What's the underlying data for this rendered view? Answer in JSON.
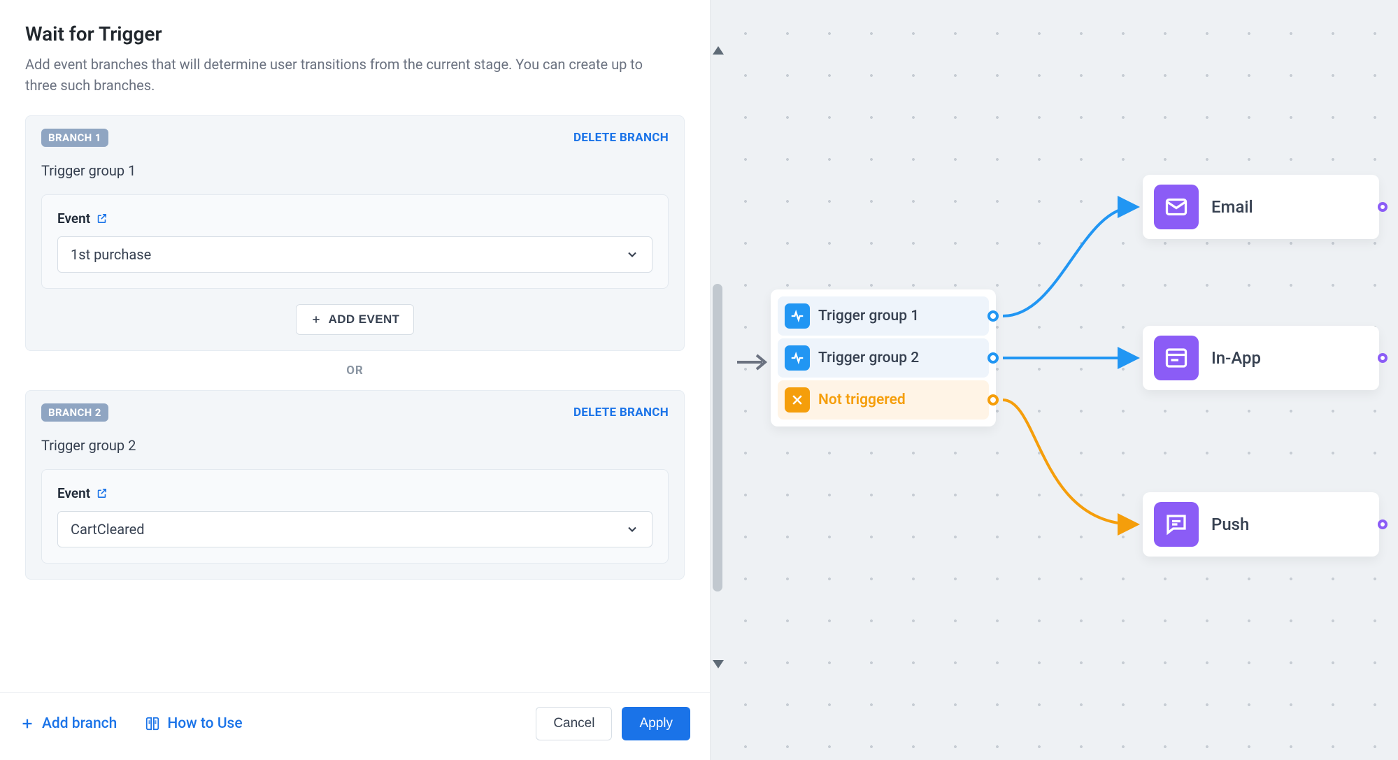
{
  "page": {
    "title": "Wait for Trigger",
    "description": "Add event branches that will determine user transitions from the current stage. You can create up to three such branches."
  },
  "branches": [
    {
      "chip": "BRANCH 1",
      "delete_label": "DELETE BRANCH",
      "group_name": "Trigger group 1",
      "event_label": "Event",
      "event_value": "1st purchase",
      "add_event_label": "ADD EVENT"
    },
    {
      "chip": "BRANCH 2",
      "delete_label": "DELETE BRANCH",
      "group_name": "Trigger group 2",
      "event_label": "Event",
      "event_value": "CartCleared"
    }
  ],
  "separator": {
    "or": "OR"
  },
  "footer": {
    "add_branch": "Add branch",
    "how_to_use": "How to Use",
    "cancel": "Cancel",
    "apply": "Apply"
  },
  "flow": {
    "node_rows": [
      {
        "label": "Trigger group 1",
        "style": "blue"
      },
      {
        "label": "Trigger group 2",
        "style": "blue"
      },
      {
        "label": "Not triggered",
        "style": "orange"
      }
    ],
    "destinations": [
      {
        "label": "Email",
        "icon": "email"
      },
      {
        "label": "In-App",
        "icon": "inapp"
      },
      {
        "label": "Push",
        "icon": "push"
      }
    ]
  }
}
